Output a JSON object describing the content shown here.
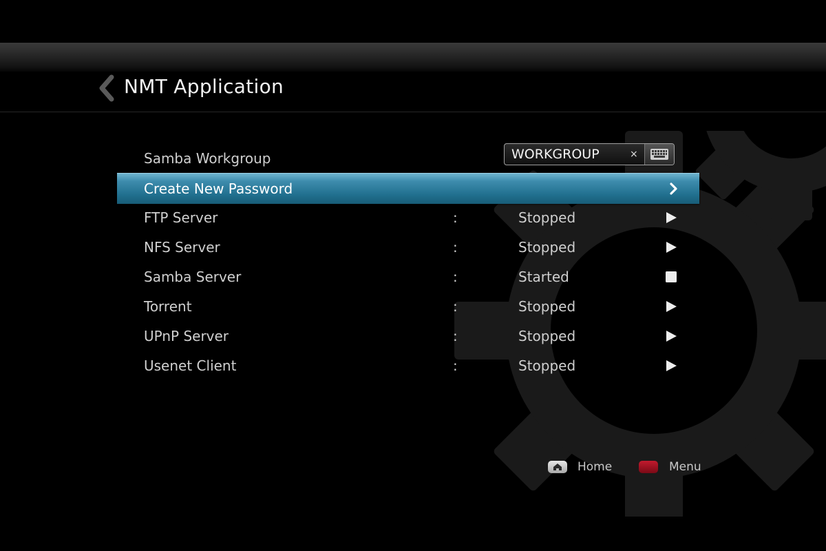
{
  "header": {
    "title": "NMT Application"
  },
  "settings": {
    "workgroup": {
      "label": "Samba Workgroup",
      "value": "WORKGROUP",
      "clear_glyph": "×"
    },
    "create_password": {
      "label": "Create New Password"
    },
    "services": [
      {
        "label": "FTP Server",
        "colon": ":",
        "status": "Stopped",
        "action_icon": "play-icon"
      },
      {
        "label": "NFS Server",
        "colon": ":",
        "status": "Stopped",
        "action_icon": "play-icon"
      },
      {
        "label": "Samba Server",
        "colon": ":",
        "status": "Started",
        "action_icon": "stop-icon"
      },
      {
        "label": "Torrent",
        "colon": ":",
        "status": "Stopped",
        "action_icon": "play-icon"
      },
      {
        "label": "UPnP Server",
        "colon": ":",
        "status": "Stopped",
        "action_icon": "play-icon"
      },
      {
        "label": "Usenet Client",
        "colon": ":",
        "status": "Stopped",
        "action_icon": "play-icon"
      }
    ]
  },
  "footer": {
    "home_label": "Home",
    "menu_label": "Menu"
  },
  "colors": {
    "selection": "#2a7d9e",
    "menu_button": "#a8121f",
    "background": "#000000"
  }
}
